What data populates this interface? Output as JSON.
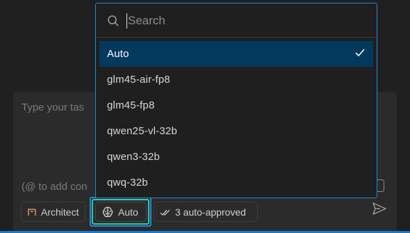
{
  "composer": {
    "placeholder_top": "Type your tas",
    "placeholder_bottom": "(@ to add con"
  },
  "mode_chip": {
    "label": "Architect",
    "icon": "architect-icon"
  },
  "model_chip": {
    "label": "Auto",
    "icon": "brain-icon"
  },
  "approval_chip": {
    "label": "3 auto-approved",
    "icon": "double-check-icon"
  },
  "model_menu": {
    "search_placeholder": "Search",
    "options": [
      {
        "label": "Auto",
        "selected": true
      },
      {
        "label": "glm45-air-fp8",
        "selected": false
      },
      {
        "label": "glm45-fp8",
        "selected": false
      },
      {
        "label": "qwen25-vl-32b",
        "selected": false
      },
      {
        "label": "qwen3-32b",
        "selected": false
      },
      {
        "label": "qwq-32b",
        "selected": false
      }
    ]
  },
  "colors": {
    "accent": "#1f8ad8",
    "selection": "#04395e",
    "focus_inner": "#30c9b0"
  }
}
